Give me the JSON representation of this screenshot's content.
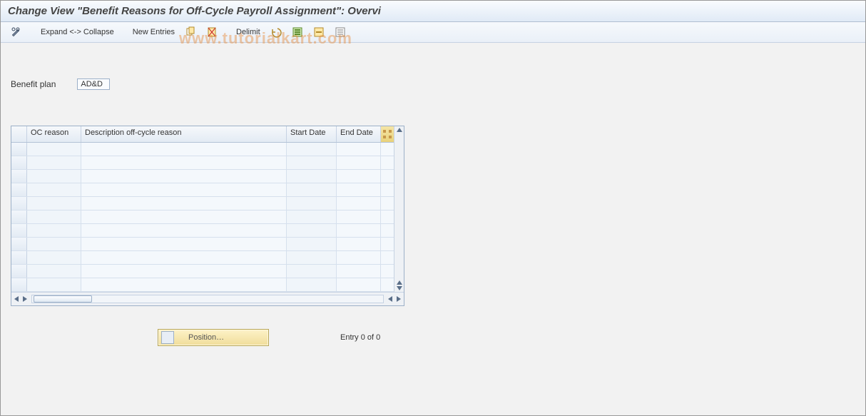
{
  "title": "Change View \"Benefit Reasons for Off-Cycle Payroll Assignment\": Overvi",
  "toolbar": {
    "expand_collapse_label": "Expand <-> Collapse",
    "new_entries_label": "New Entries",
    "delimit_label": "Delimit"
  },
  "watermark": "www.tutorialkart.com",
  "benefit_plan": {
    "label": "Benefit plan",
    "value": "AD&D"
  },
  "table": {
    "columns": {
      "oc_reason": "OC reason",
      "description": "Description off-cycle reason",
      "start_date": "Start Date",
      "end_date": "End Date"
    },
    "row_count": 11
  },
  "position_button_label": "Position…",
  "entry_status": "Entry 0 of 0"
}
